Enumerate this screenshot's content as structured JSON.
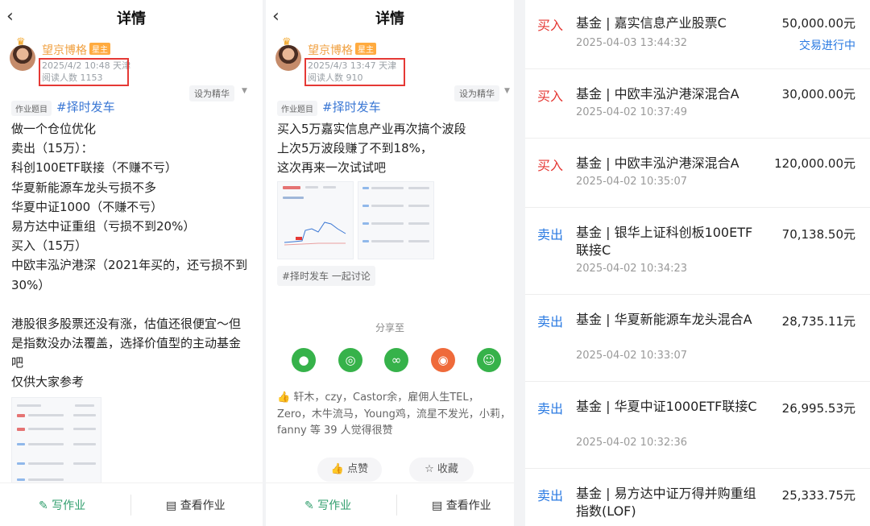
{
  "colors": {
    "buy": "#e53935",
    "sell": "#2a7ae2",
    "topic": "#3a77d4",
    "highlight": "#e53935"
  },
  "p1": {
    "back": "‹",
    "title": "详情",
    "author": {
      "name": "望京博格",
      "badge": "星主",
      "date_city": "2025/4/2 10:48  天津",
      "reads": "阅读人数 1153"
    },
    "elite": "设为精华",
    "tag": "作业题目",
    "topic": "#择时发车",
    "lines": [
      "做一个仓位优化",
      "卖出（15万）：",
      "科创100ETF联接（不赚不亏）",
      "华夏新能源车龙头亏损不多",
      "华夏中证1000（不赚不亏）",
      "易方达中证重组（亏损不到20%）",
      "买入（15万）",
      "中欧丰泓沪港深（2021年买的，还亏损不到",
      "30%）",
      "",
      "港股很多股票还没有涨，估值还很便宜～但",
      "是指数没办法覆盖，选择价值型的主动基金",
      "吧",
      "仅供大家参考"
    ],
    "write": "写作业",
    "view": "查看作业"
  },
  "p2": {
    "back": "‹",
    "title": "详情",
    "author": {
      "name": "望京博格",
      "badge": "星主",
      "date_city": "2025/4/3 13:47  天津",
      "reads": "阅读人数 910"
    },
    "elite": "设为精华",
    "tag": "作业题目",
    "topic": "#择时发车",
    "lines": [
      "买入5万嘉实信息产业再次搞个波段",
      "上次5万波段赚了不到18%，",
      "这次再来一次试试吧"
    ],
    "hashchip": "#择时发车  一起讨论",
    "share": "分享至",
    "likes": "轩木，czy，Castor余，雇佣人生TEL，Zero，木牛流马，Young鸡，流星不发光，小莉，fanny 等 39 人觉得很赞",
    "like_btn": "点赞",
    "fav_btn": "收藏",
    "write": "写作业",
    "view": "查看作业"
  },
  "orders": [
    {
      "type": "买入",
      "kind": "buy",
      "name": "基金 | 嘉实信息产业股票C",
      "date": "2025-04-03 13:44:32",
      "amount": "50,000.00元",
      "status": "交易进行中"
    },
    {
      "type": "买入",
      "kind": "buy",
      "name": "基金 | 中欧丰泓沪港深混合A",
      "date": "2025-04-02 10:37:49",
      "amount": "30,000.00元"
    },
    {
      "type": "买入",
      "kind": "buy",
      "name": "基金 | 中欧丰泓沪港深混合A",
      "date": "2025-04-02 10:35:07",
      "amount": "120,000.00元"
    },
    {
      "type": "卖出",
      "kind": "sell",
      "name": "基金 | 银华上证科创板100ETF联接C",
      "date": "2025-04-02 10:34:23",
      "amount": "70,138.50元"
    },
    {
      "type": "卖出",
      "kind": "sell",
      "name": "基金 | 华夏新能源车龙头混合A",
      "date": "2025-04-02 10:33:07",
      "amount": "28,735.11元"
    },
    {
      "type": "卖出",
      "kind": "sell",
      "name": "基金 | 华夏中证1000ETF联接C",
      "date": "2025-04-02 10:32:36",
      "amount": "26,995.53元"
    },
    {
      "type": "卖出",
      "kind": "sell",
      "name": "基金 | 易方达中证万得并购重组指数(LOF)",
      "date": "",
      "amount": "25,333.75元"
    }
  ]
}
